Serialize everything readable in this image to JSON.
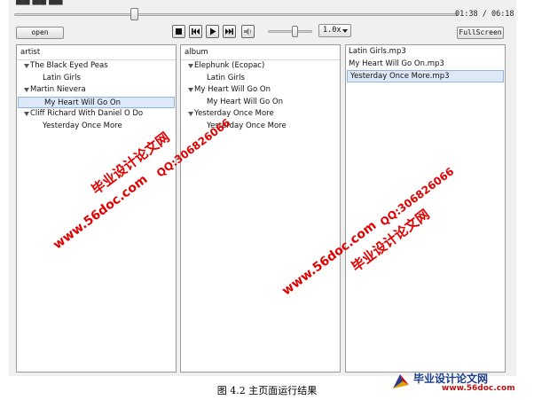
{
  "player": {
    "clip_title": "██ ██ ██",
    "progress": 0.27,
    "time_current": "01:38",
    "time_separator": " / ",
    "time_total": "06:18",
    "open_label": "open",
    "fullscreen_label": "FullScreen",
    "volume": 0.6,
    "speed_value": "1.0x",
    "controls": [
      "stop-icon",
      "previous-icon",
      "play-icon",
      "next-icon",
      "speaker-icon"
    ]
  },
  "artist_pane": {
    "header": "artist",
    "items": [
      {
        "label": "The Black Eyed Peas",
        "level": 0,
        "expanded": true
      },
      {
        "label": "Latin Girls",
        "level": 1
      },
      {
        "label": "Martin Nievera",
        "level": 0,
        "expanded": true
      },
      {
        "label": "My Heart Will Go On",
        "level": 1,
        "selected": true
      },
      {
        "label": "Cliff Richard With Daniel O Do",
        "level": 0,
        "expanded": true
      },
      {
        "label": "Yesterday Once More",
        "level": 1
      }
    ]
  },
  "album_pane": {
    "header": "album",
    "items": [
      {
        "label": "Elephunk (Ecopac)",
        "level": 0,
        "expanded": true
      },
      {
        "label": "Latin Girls",
        "level": 1
      },
      {
        "label": "My Heart Will Go On",
        "level": 0,
        "expanded": true
      },
      {
        "label": "My Heart Will Go On",
        "level": 1
      },
      {
        "label": "Yesterday Once More",
        "level": 0,
        "expanded": true
      },
      {
        "label": "Yesterday Once More",
        "level": 1
      }
    ]
  },
  "files_pane": {
    "items": [
      {
        "label": "Latin Girls.mp3"
      },
      {
        "label": "My Heart Will Go On.mp3"
      },
      {
        "label": "Yesterday Once More.mp3",
        "selected": true
      }
    ]
  },
  "watermarks": {
    "site_cn": "毕业设计论文网",
    "url": "www.56doc.com",
    "qq": "QQ:306826066"
  },
  "caption": "图 4.2  主页面运行结果",
  "logo": {
    "text_cn": "毕业设计论文网",
    "url": "www.56doc.com"
  },
  "colors": {
    "watermark": "#e00000",
    "selection": "#dde9f7",
    "logo_blue": "#1a3c8c"
  }
}
